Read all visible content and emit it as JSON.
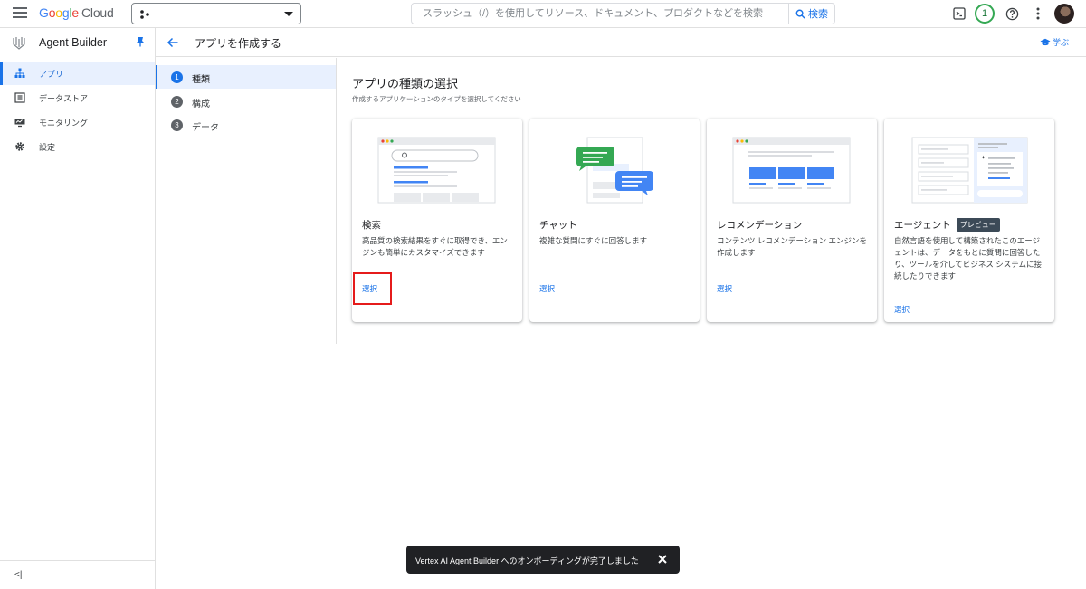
{
  "topbar": {
    "logo": {
      "google": "Google",
      "cloud": "Cloud"
    },
    "search": {
      "placeholder": "スラッシュ（/）を使用してリソース、ドキュメント、プロダクトなどを検索",
      "button_label": "検索"
    },
    "notifications_count": "1"
  },
  "sidebar": {
    "product_name": "Agent Builder",
    "items": [
      {
        "label": "アプリ",
        "icon": "apps-hierarchy-icon",
        "active": true
      },
      {
        "label": "データストア",
        "icon": "datastore-icon",
        "active": false
      },
      {
        "label": "モニタリング",
        "icon": "monitoring-icon",
        "active": false
      },
      {
        "label": "設定",
        "icon": "gear-icon",
        "active": false
      }
    ]
  },
  "page": {
    "title": "アプリを作成する",
    "learn_label": "学ぶ"
  },
  "steps": [
    {
      "number": "1",
      "label": "種類",
      "active": true
    },
    {
      "number": "2",
      "label": "構成",
      "active": false
    },
    {
      "number": "3",
      "label": "データ",
      "active": false
    }
  ],
  "content": {
    "title": "アプリの種類の選択",
    "subtitle": "作成するアプリケーションのタイプを選択してください"
  },
  "cards": [
    {
      "title": "検索",
      "description": "高品質の検索結果をすぐに取得でき、エンジンも簡単にカスタマイズできます",
      "select_label": "選択"
    },
    {
      "title": "チャット",
      "description": "複雑な質問にすぐに回答します",
      "select_label": "選択"
    },
    {
      "title": "レコメンデーション",
      "description": "コンテンツ レコメンデーション エンジンを作成します",
      "select_label": "選択"
    },
    {
      "title": "エージェント",
      "badge": "プレビュー",
      "description": "自然言語を使用して構築されたこのエージェントは、データをもとに質問に回答したり、ツールを介してビジネス システムに接続したりできます",
      "select_label": "選択"
    }
  ],
  "toast": {
    "message": "Vertex AI Agent Builder へのオンボーディングが完了しました"
  },
  "colors": {
    "accent": "#1a73e8",
    "active_bg": "#e8f0fe",
    "highlight": "#e51b1b",
    "toast_bg": "#202124"
  }
}
